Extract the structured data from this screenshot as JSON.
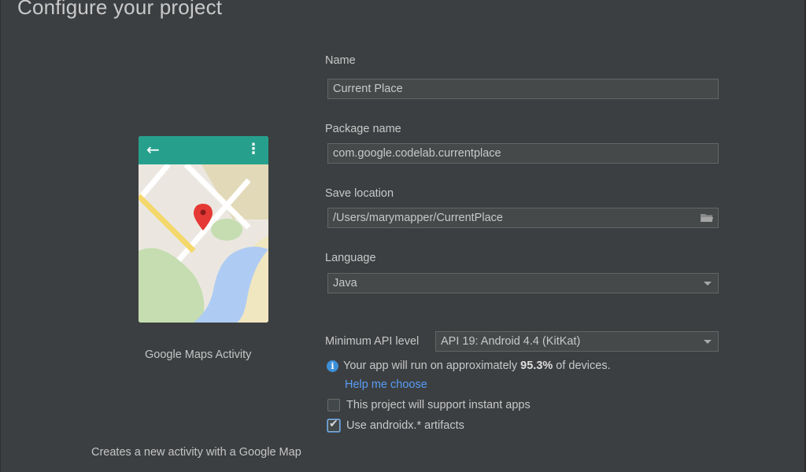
{
  "page": {
    "title": "Configure your project"
  },
  "template": {
    "name": "Google Maps Activity",
    "description": "Creates a new activity with a Google Map",
    "preview_colors": {
      "appbar": "#26a08c",
      "pin": "#e53935",
      "water": "#aecbf3",
      "park": "#c5ddb0",
      "road_yellow": "#f4d86b"
    }
  },
  "form": {
    "name": {
      "label": "Name",
      "value": "Current Place"
    },
    "package": {
      "label": "Package name",
      "value": "com.google.codelab.currentplace"
    },
    "save_location": {
      "label": "Save location",
      "value": "/Users/marymapper/CurrentPlace",
      "icon": "folder-icon"
    },
    "language": {
      "label": "Language",
      "value": "Java"
    },
    "min_api": {
      "label": "Minimum API level",
      "value": "API 19: Android 4.4 (KitKat)"
    },
    "info": {
      "prefix": "Your app will run on approximately ",
      "percent": "95.3%",
      "suffix": " of devices.",
      "help_link": "Help me choose"
    },
    "instant_apps": {
      "label": "This project will support instant apps",
      "checked": false
    },
    "androidx": {
      "label": "Use androidx.* artifacts",
      "checked": true
    }
  },
  "accent_color": "#589df6"
}
